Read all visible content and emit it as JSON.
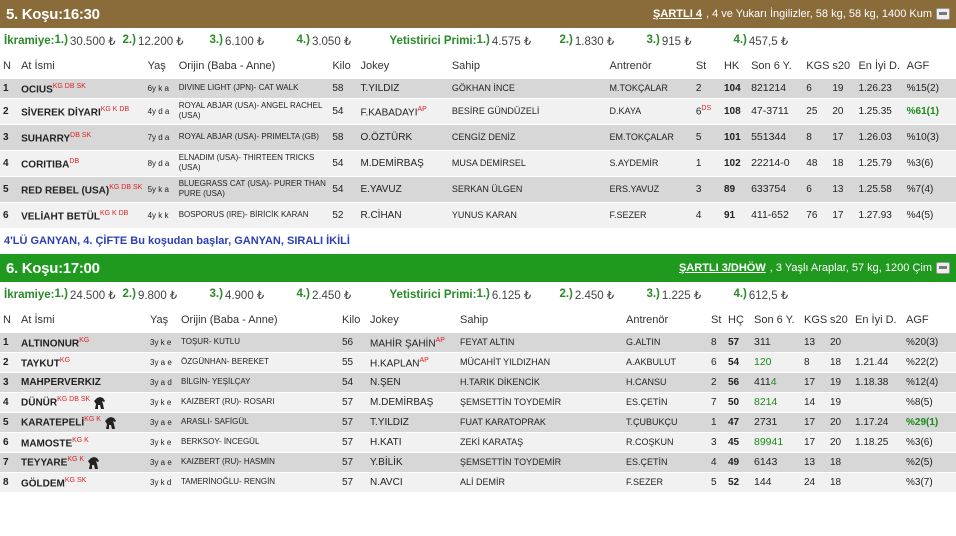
{
  "race5": {
    "title": "5. Koşu:16:30",
    "condition": "ŞARTLI 4",
    "detail": ", 4 ve Yukarı İngilizler, 58 kg, 58 kg, 1400 Kum",
    "prize_label": "İkramiye:",
    "prizes": [
      {
        "rank": "1.)",
        "amount": "30.500 ₺"
      },
      {
        "rank": "2.)",
        "amount": "12.200 ₺"
      },
      {
        "rank": "3.)",
        "amount": "6.100 ₺"
      },
      {
        "rank": "4.)",
        "amount": "3.050 ₺"
      }
    ],
    "breeder_label": "Yetistirici Primi:",
    "breeder_prizes": [
      {
        "rank": "1.)",
        "amount": "4.575 ₺"
      },
      {
        "rank": "2.)",
        "amount": "1.830 ₺"
      },
      {
        "rank": "3.)",
        "amount": "915 ₺"
      },
      {
        "rank": "4.)",
        "amount": "457,5 ₺"
      }
    ],
    "headers": [
      "N",
      "At İsmi",
      "Yaş",
      "Orijin (Baba - Anne)",
      "Kilo",
      "Jokey",
      "Sahip",
      "Antrenör",
      "St",
      "HK",
      "Son 6 Y.",
      "KGS",
      "s20",
      "En İyi D.",
      "AGF"
    ],
    "rows": [
      {
        "n": "1",
        "name": "OCIUS",
        "tags": "KG DB SK",
        "age": "6y k a",
        "origin": "DIVINE LIGHT (JPN)- CAT WALK",
        "kilo": "58",
        "jockey": "T.YILDIZ",
        "jtag": "",
        "owner": "GÖKHAN İNCE",
        "trainer": "M.TOKÇALAR",
        "st": "2",
        "sttag": "",
        "hk": "104",
        "son": "821214",
        "kgs": "6",
        "s20": "19",
        "best": "1.26.23",
        "agf": "%15(2)",
        "agf_hl": false
      },
      {
        "n": "2",
        "name": "SİVEREK DİYARI",
        "tags": "KG K DB",
        "age": "4y d a",
        "origin": "ROYAL ABJAR (USA)- ANGEL RACHEL (USA)",
        "kilo": "54",
        "jockey": "F.KABADAYI",
        "jtag": "AP",
        "owner": "BESİRE GÜNDÜZELİ",
        "trainer": "D.KAYA",
        "st": "6",
        "sttag": "DS",
        "hk": "108",
        "son": "47-3711",
        "kgs": "25",
        "s20": "20",
        "best": "1.25.35",
        "agf": "%61(1)",
        "agf_hl": true
      },
      {
        "n": "3",
        "name": "SUHARRY",
        "tags": "DB SK",
        "age": "7y d a",
        "origin": "ROYAL ABJAR (USA)- PRIMELTA (GB)",
        "kilo": "58",
        "jockey": "O.ÖZTÜRK",
        "jtag": "",
        "owner": "CENGİZ DENİZ",
        "trainer": "EM.TOKÇALAR",
        "st": "5",
        "sttag": "",
        "hk": "101",
        "son": "551344",
        "kgs": "8",
        "s20": "17",
        "best": "1.26.03",
        "agf": "%10(3)",
        "agf_hl": false
      },
      {
        "n": "4",
        "name": "CORITIBA",
        "tags": "DB",
        "age": "8y d a",
        "origin": "ELNADIM (USA)- THIRTEEN TRICKS (USA)",
        "kilo": "54",
        "jockey": "M.DEMİRBAŞ",
        "jtag": "",
        "owner": "MUSA DEMİRSEL",
        "trainer": "S.AYDEMİR",
        "st": "1",
        "sttag": "",
        "hk": "102",
        "son": "22214-0",
        "kgs": "48",
        "s20": "18",
        "best": "1.25.79",
        "agf": "%3(6)",
        "agf_hl": false
      },
      {
        "n": "5",
        "name": "RED REBEL (USA)",
        "tags": "KG DB SK",
        "age": "5y k a",
        "origin": "BLUEGRASS CAT (USA)- PURER THAN PURE (USA)",
        "kilo": "54",
        "jockey": "E.YAVUZ",
        "jtag": "",
        "owner": "SERKAN ÜLGEN",
        "trainer": "ERS.YAVUZ",
        "st": "3",
        "sttag": "",
        "hk": "89",
        "son": "633754",
        "kgs": "6",
        "s20": "13",
        "best": "1.25.58",
        "agf": "%7(4)",
        "agf_hl": false
      },
      {
        "n": "6",
        "name": "VELİAHT BETÜL",
        "tags": "KG K DB",
        "age": "4y k k",
        "origin": "BOSPORUS (IRE)- BİRİCİK KARAN",
        "kilo": "52",
        "jockey": "R.CİHAN",
        "jtag": "",
        "owner": "YUNUS KARAN",
        "trainer": "F.SEZER",
        "st": "4",
        "sttag": "",
        "hk": "91",
        "son": "411-652",
        "kgs": "76",
        "s20": "17",
        "best": "1.27.93",
        "agf": "%4(5)",
        "agf_hl": false
      }
    ],
    "note": "4'LÜ GANYAN, 4. ÇİFTE Bu koşudan başlar, GANYAN, SIRALI İKİLİ"
  },
  "race6": {
    "title": "6. Koşu:17:00",
    "condition": "ŞARTLI 3/DHÖW",
    "detail": ", 3 Yaşlı Araplar, 57 kg, 1200 Çim",
    "prize_label": "İkramiye:",
    "prizes": [
      {
        "rank": "1.)",
        "amount": "24.500 ₺"
      },
      {
        "rank": "2.)",
        "amount": "9.800 ₺"
      },
      {
        "rank": "3.)",
        "amount": "4.900 ₺"
      },
      {
        "rank": "4.)",
        "amount": "2.450 ₺"
      }
    ],
    "breeder_label": "Yetistirici Primi:",
    "breeder_prizes": [
      {
        "rank": "1.)",
        "amount": "6.125 ₺"
      },
      {
        "rank": "2.)",
        "amount": "2.450 ₺"
      },
      {
        "rank": "3.)",
        "amount": "1.225 ₺"
      },
      {
        "rank": "4.)",
        "amount": "612,5 ₺"
      }
    ],
    "headers": [
      "N",
      "At İsmi",
      "Yaş",
      "Orijin (Baba - Anne)",
      "Kilo",
      "Jokey",
      "Sahip",
      "Antrenör",
      "St",
      "HÇ",
      "Son 6 Y.",
      "KGS",
      "s20",
      "En İyi D.",
      "AGF"
    ],
    "rows": [
      {
        "n": "1",
        "name": "ALTINONUR",
        "tags": "KG",
        "icon": false,
        "age": "3y k e",
        "origin": "TOŞUR- KUTLU",
        "kilo": "56",
        "jockey": "MAHİR ŞAHİN",
        "jtag": "AP",
        "owner": "FEYAT ALTIN",
        "trainer": "G.ALTIN",
        "st": "8",
        "sttag": "",
        "hk": "57",
        "son": "311",
        "son_green": "",
        "kgs": "13",
        "s20": "20",
        "best": "",
        "agf": "%20(3)",
        "agf_hl": false
      },
      {
        "n": "2",
        "name": "TAYKUT",
        "tags": "KG",
        "icon": false,
        "age": "3y a e",
        "origin": "ÖZGÜNHAN- BEREKET",
        "kilo": "55",
        "jockey": "H.KAPLAN",
        "jtag": "AP",
        "owner": "MÜCAHİT YILDIZHAN",
        "trainer": "A.AKBULUT",
        "st": "6",
        "sttag": "",
        "hk": "54",
        "son": "",
        "son_green": "120",
        "kgs": "8",
        "s20": "18",
        "best": "1.21.44",
        "agf": "%22(2)",
        "agf_hl": false
      },
      {
        "n": "3",
        "name": "MAHPERVERKIZ",
        "tags": "",
        "icon": false,
        "age": "3y a d",
        "origin": "BİLGİN- YEŞİLÇAY",
        "kilo": "54",
        "jockey": "N.ŞEN",
        "jtag": "",
        "owner": "H.TARIK DİKENCİK",
        "trainer": "H.CANSU",
        "st": "2",
        "sttag": "",
        "hk": "56",
        "son": "411",
        "son_green": "4",
        "kgs": "17",
        "s20": "19",
        "best": "1.18.38",
        "agf": "%12(4)",
        "agf_hl": false
      },
      {
        "n": "4",
        "name": "DÜNÜR",
        "tags": "KG DB SK",
        "icon": true,
        "age": "3y k e",
        "origin": "KAIZBERT (RU)- ROSARI",
        "kilo": "57",
        "jockey": "M.DEMİRBAŞ",
        "jtag": "",
        "owner": "ŞEMSETTİN TOYDEMİR",
        "trainer": "ES.ÇETİN",
        "st": "7",
        "sttag": "",
        "hk": "50",
        "son": "",
        "son_green": "8214",
        "kgs": "14",
        "s20": "19",
        "best": "",
        "agf": "%8(5)",
        "agf_hl": false
      },
      {
        "n": "5",
        "name": "KARATEPELİ",
        "tags": "KG K",
        "icon": true,
        "age": "3y a e",
        "origin": "ARASLI- SAFİGÜL",
        "kilo": "57",
        "jockey": "T.YILDIZ",
        "jtag": "",
        "owner": "FUAT KARATOPRAK",
        "trainer": "T.ÇUBUKÇU",
        "st": "1",
        "sttag": "",
        "hk": "47",
        "son": "2731",
        "son_green": "",
        "kgs": "17",
        "s20": "20",
        "best": "1.17.24",
        "agf": "%29(1)",
        "agf_hl": true
      },
      {
        "n": "6",
        "name": "MAMOSTE",
        "tags": "KG K",
        "icon": false,
        "age": "3y k e",
        "origin": "BERKSOY- İNCEGÜL",
        "kilo": "57",
        "jockey": "H.KATI",
        "jtag": "",
        "owner": "ZEKİ KARATAŞ",
        "trainer": "R.COŞKUN",
        "st": "3",
        "sttag": "",
        "hk": "45",
        "son": "",
        "son_green": "89941",
        "kgs": "17",
        "s20": "20",
        "best": "1.18.25",
        "agf": "%3(6)",
        "agf_hl": false
      },
      {
        "n": "7",
        "name": "TEYYARE",
        "tags": "KG K",
        "icon": true,
        "age": "3y a e",
        "origin": "KAIZBERT (RU)- HASMİN",
        "kilo": "57",
        "jockey": "Y.BİLİK",
        "jtag": "",
        "owner": "ŞEMSETTİN TOYDEMİR",
        "trainer": "ES.ÇETİN",
        "st": "4",
        "sttag": "",
        "hk": "49",
        "son": "6143",
        "son_green": "",
        "kgs": "13",
        "s20": "18",
        "best": "",
        "agf": "%2(5)",
        "agf_hl": false
      },
      {
        "n": "8",
        "name": "GÖLDEM",
        "tags": "KG SK",
        "icon": false,
        "age": "3y k d",
        "origin": "TAMERİNOĞLU- RENGİN",
        "kilo": "57",
        "jockey": "N.AVCI",
        "jtag": "",
        "owner": "ALİ DEMİR",
        "trainer": "F.SEZER",
        "st": "5",
        "sttag": "",
        "hk": "52",
        "son": "144",
        "son_green": "",
        "kgs": "24",
        "s20": "18",
        "best": "",
        "agf": "%3(7)",
        "agf_hl": false
      }
    ]
  }
}
